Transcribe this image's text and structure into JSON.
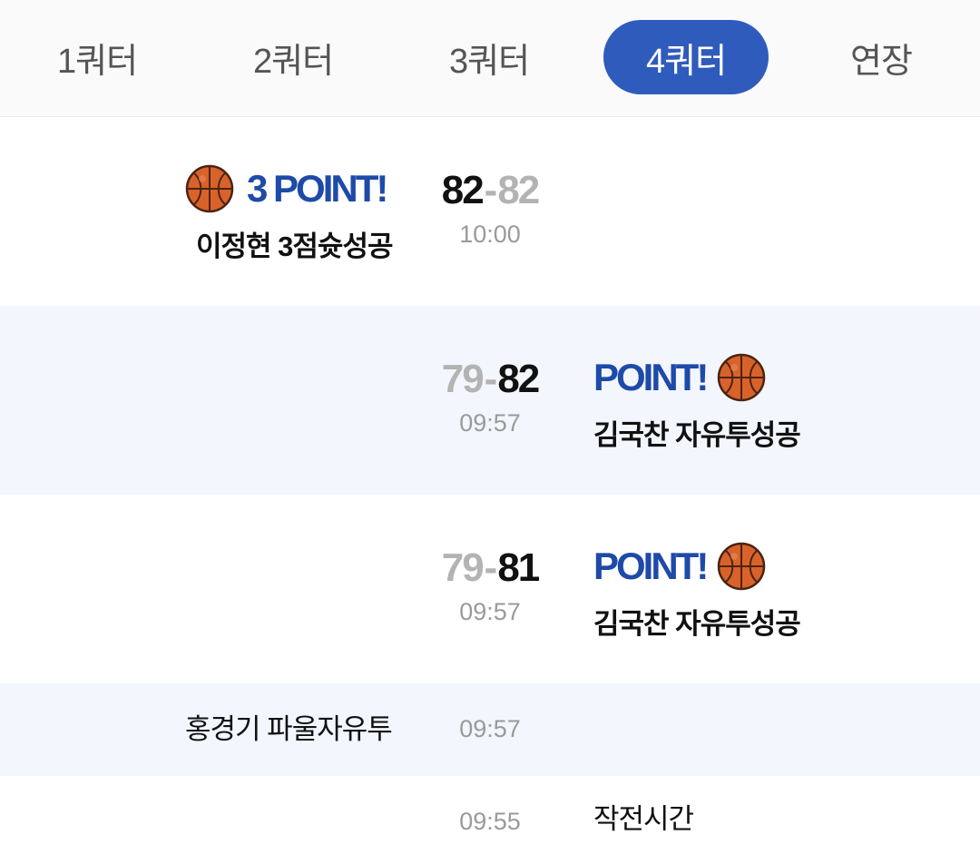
{
  "tabs": [
    {
      "label": "1쿼터",
      "active": false
    },
    {
      "label": "2쿼터",
      "active": false
    },
    {
      "label": "3쿼터",
      "active": false
    },
    {
      "label": "4쿼터",
      "active": true
    },
    {
      "label": "연장",
      "active": false
    }
  ],
  "events": [
    {
      "side": "left",
      "headline": "3 POINT!",
      "description": "이정현 3점슛성공",
      "score_left": "82",
      "score_right": "82",
      "time": "10:00",
      "icon": "basketball-icon"
    },
    {
      "side": "right",
      "headline": "POINT!",
      "description": "김국찬 자유투성공",
      "score_left": "79",
      "score_right": "82",
      "time": "09:57",
      "icon": "basketball-icon"
    },
    {
      "side": "right",
      "headline": "POINT!",
      "description": "김국찬 자유투성공",
      "score_left": "79",
      "score_right": "81",
      "time": "09:57",
      "icon": "basketball-icon"
    },
    {
      "side": "left",
      "description": "홍경기 파울자유투",
      "time": "09:57"
    },
    {
      "side": "right",
      "description": "작전시간",
      "time": "09:55"
    }
  ],
  "colors": {
    "accent": "#2f5bbd",
    "headline": "#1e4aa8",
    "shade": "#f3f7fd",
    "dim_score": "#b3b3b3"
  }
}
